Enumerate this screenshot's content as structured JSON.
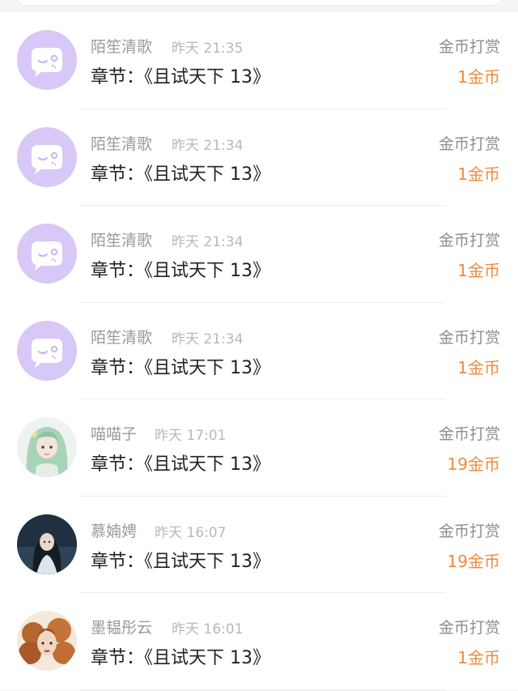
{
  "entries": [
    {
      "name": "陌笙清歌",
      "time": "昨天 21:35",
      "chapter": "章节：《且试天下 13》",
      "type": "金币打赏",
      "amount": "1金币",
      "avatar": "default-avatar-icon"
    },
    {
      "name": "陌笙清歌",
      "time": "昨天 21:34",
      "chapter": "章节：《且试天下 13》",
      "type": "金币打赏",
      "amount": "1金币",
      "avatar": "default-avatar-icon"
    },
    {
      "name": "陌笙清歌",
      "time": "昨天 21:34",
      "chapter": "章节：《且试天下 13》",
      "type": "金币打赏",
      "amount": "1金币",
      "avatar": "default-avatar-icon"
    },
    {
      "name": "陌笙清歌",
      "time": "昨天 21:34",
      "chapter": "章节：《且试天下 13》",
      "type": "金币打赏",
      "amount": "1金币",
      "avatar": "default-avatar-icon"
    },
    {
      "name": "喵喵子",
      "time": "昨天 17:01",
      "chapter": "章节：《且试天下 13》",
      "type": "金币打赏",
      "amount": "19金币",
      "avatar": "user-photo-green-hair"
    },
    {
      "name": "慕婻娉",
      "time": "昨天 16:07",
      "chapter": "章节：《且试天下 13》",
      "type": "金币打赏",
      "amount": "19金币",
      "avatar": "user-photo-dark"
    },
    {
      "name": "墨韫彤云",
      "time": "昨天 16:01",
      "chapter": "章节：《且试天下 13》",
      "type": "金币打赏",
      "amount": "1金币",
      "avatar": "user-photo-curly-hair"
    }
  ],
  "colors": {
    "coin_amount": "#f08a3c",
    "default_avatar_bg": "#d7c8f7"
  }
}
